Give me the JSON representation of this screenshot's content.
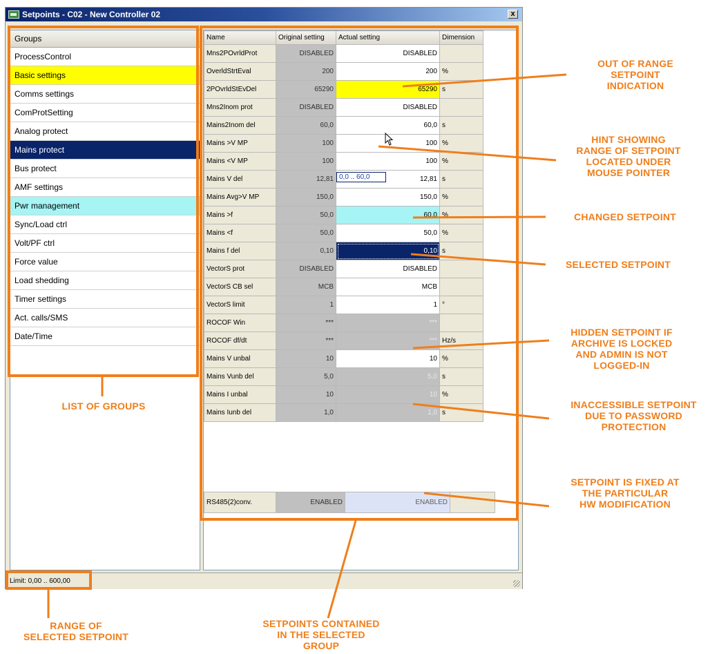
{
  "window": {
    "title": "Setpoints - C02 - New Controller 02",
    "close_label": "x"
  },
  "groups": {
    "header": "Groups",
    "items": [
      {
        "label": "ProcessControl",
        "state": "normal"
      },
      {
        "label": "Basic settings",
        "state": "yellow"
      },
      {
        "label": "Comms settings",
        "state": "normal"
      },
      {
        "label": "ComProtSetting",
        "state": "normal"
      },
      {
        "label": "Analog protect",
        "state": "normal"
      },
      {
        "label": "Mains protect",
        "state": "selected"
      },
      {
        "label": "Bus protect",
        "state": "normal"
      },
      {
        "label": "AMF settings",
        "state": "normal"
      },
      {
        "label": "Pwr management",
        "state": "cyan"
      },
      {
        "label": "Sync/Load ctrl",
        "state": "normal"
      },
      {
        "label": "Volt/PF ctrl",
        "state": "normal"
      },
      {
        "label": "Force value",
        "state": "normal"
      },
      {
        "label": "Load shedding",
        "state": "normal"
      },
      {
        "label": "Timer settings",
        "state": "normal"
      },
      {
        "label": "Act. calls/SMS",
        "state": "normal"
      },
      {
        "label": "Date/Time",
        "state": "normal"
      }
    ]
  },
  "table": {
    "columns": [
      "Name",
      "Original setting",
      "Actual setting",
      "Dimension"
    ],
    "rows": [
      {
        "name": "Mns2POvrldProt",
        "orig": "DISABLED",
        "actual": "DISABLED",
        "dim": "",
        "state": "normal"
      },
      {
        "name": "OverldStrtEval",
        "orig": "200",
        "actual": "200",
        "dim": "%",
        "state": "normal"
      },
      {
        "name": "2POvrldStEvDel",
        "orig": "65290",
        "actual": "65290",
        "dim": "s",
        "state": "yellow"
      },
      {
        "name": "Mns2Inom prot",
        "orig": "DISABLED",
        "actual": "DISABLED",
        "dim": "",
        "state": "normal"
      },
      {
        "name": "Mains2Inom del",
        "orig": "60,0",
        "actual": "60,0",
        "dim": "s",
        "state": "normal"
      },
      {
        "name": "Mains >V MP",
        "orig": "100",
        "actual": "100",
        "dim": "%",
        "state": "normal"
      },
      {
        "name": "Mains <V MP",
        "orig": "100",
        "actual": "100",
        "dim": "%",
        "state": "normal"
      },
      {
        "name": "Mains V del",
        "orig": "12,81",
        "actual": "12,81",
        "dim": "s",
        "state": "normal"
      },
      {
        "name": "Mains Avg>V MP",
        "orig": "150,0",
        "actual": "150,0",
        "dim": "%",
        "state": "normal"
      },
      {
        "name": "Mains >f",
        "orig": "50,0",
        "actual": "60,0",
        "dim": "%",
        "state": "cyan"
      },
      {
        "name": "Mains <f",
        "orig": "50,0",
        "actual": "50,0",
        "dim": "%",
        "state": "normal"
      },
      {
        "name": "Mains f del",
        "orig": "0,10",
        "actual": "0,10",
        "dim": "s",
        "state": "selected"
      },
      {
        "name": "VectorS prot",
        "orig": "DISABLED",
        "actual": "DISABLED",
        "dim": "",
        "state": "normal"
      },
      {
        "name": "VectorS CB sel",
        "orig": "MCB",
        "actual": "MCB",
        "dim": "",
        "state": "normal"
      },
      {
        "name": "VectorS limit",
        "orig": "1",
        "actual": "1",
        "dim": "°",
        "state": "normal"
      },
      {
        "name": "ROCOF Win",
        "orig": "***",
        "actual": "***",
        "dim": "",
        "state": "gray"
      },
      {
        "name": "ROCOF df/dt",
        "orig": "***",
        "actual": "***",
        "dim": "Hz/s",
        "state": "gray"
      },
      {
        "name": "Mains V unbal",
        "orig": "10",
        "actual": "10",
        "dim": "%",
        "state": "normal"
      },
      {
        "name": "Mains Vunb del",
        "orig": "5,0",
        "actual": "5,0",
        "dim": "s",
        "state": "gray"
      },
      {
        "name": "Mains I unbal",
        "orig": "10",
        "actual": "10",
        "dim": "%",
        "state": "gray"
      },
      {
        "name": "Mains Iunb del",
        "orig": "1,0",
        "actual": "1,0",
        "dim": "s",
        "state": "gray"
      }
    ],
    "fixed_row": {
      "name": "RS485(2)conv.",
      "orig": "ENABLED",
      "actual": "ENABLED",
      "dim": ""
    }
  },
  "hint": {
    "text": "0,0 .. 60,0"
  },
  "status": {
    "limit_text": "Limit: 0,00 .. 600,00"
  },
  "callouts": {
    "out_of_range": "OUT OF RANGE\nSETPOINT\nINDICATION",
    "hint_range": "HINT SHOWING\nRANGE OF SETPOINT\nLOCATED UNDER\nMOUSE POINTER",
    "changed": "CHANGED SETPOINT",
    "selected": "SELECTED SETPOINT",
    "hidden": "HIDDEN SETPOINT IF\nARCHIVE IS LOCKED\nAND ADMIN IS NOT\nLOGGED-IN",
    "inaccessible": "INACCESSIBLE SETPOINT\nDUE TO PASSWORD\nPROTECTION",
    "fixed": "SETPOINT IS FIXED AT\nTHE PARTICULAR\nHW MODIFICATION",
    "list_of_groups": "LIST OF GROUPS",
    "range_selected": "RANGE OF\nSELECTED SETPOINT",
    "setpoints_contained": "SETPOINTS CONTAINED\nIN THE SELECTED\nGROUP"
  },
  "colors": {
    "accent_orange": "#f07e1a",
    "selected_navy": "#0a246a",
    "out_of_range_yellow": "#ffff00",
    "changed_cyan": "#a6f4f4"
  }
}
